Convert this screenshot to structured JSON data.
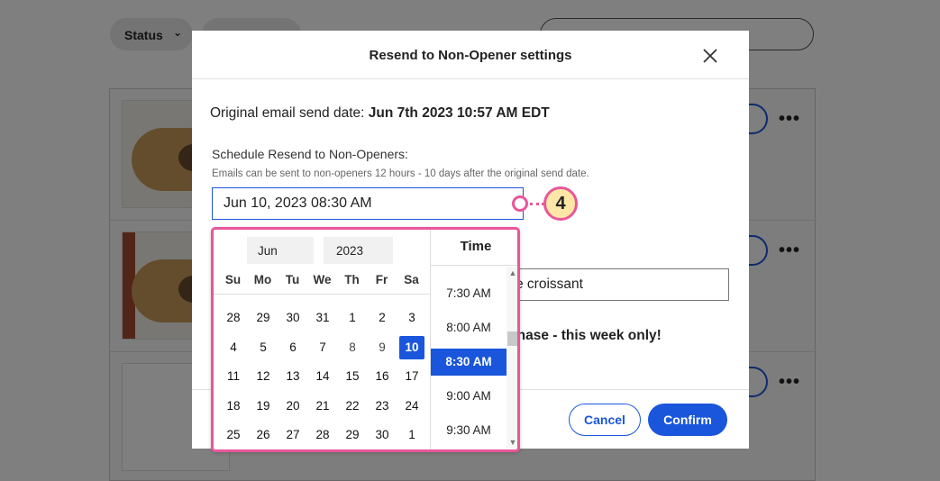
{
  "background": {
    "status_filter_label": "Status",
    "chevron_glyph": "⌄",
    "more_glyph": "•••"
  },
  "modal": {
    "title": "Resend to Non-Opener settings",
    "original_send_label": "Original email send date:",
    "original_send_value": "Jun 7th 2023 10:57 AM EDT",
    "schedule_label": "Schedule Resend to Non-Openers:",
    "schedule_hint": "Emails can be sent to non-openers 12 hours - 10 days after the original send date.",
    "date_input_value": "Jun 10, 2023 08:30 AM",
    "partial_field_text": "e croissant",
    "partial_subject_text": "chase - this week only!",
    "cancel_label": "Cancel",
    "confirm_label": "Confirm"
  },
  "datepicker": {
    "month": "Jun",
    "year": "2023",
    "weekdays": [
      "Su",
      "Mo",
      "Tu",
      "We",
      "Th",
      "Fr",
      "Sa"
    ],
    "weeks": [
      [
        "28",
        "29",
        "30",
        "31",
        "1",
        "2",
        "3"
      ],
      [
        "4",
        "5",
        "6",
        "7",
        "8",
        "9",
        "10"
      ],
      [
        "11",
        "12",
        "13",
        "14",
        "15",
        "16",
        "17"
      ],
      [
        "18",
        "19",
        "20",
        "21",
        "22",
        "23",
        "24"
      ],
      [
        "25",
        "26",
        "27",
        "28",
        "29",
        "30",
        "1"
      ]
    ],
    "selected_day": "10",
    "time_header": "Time",
    "times": [
      "7:30 AM",
      "8:00 AM",
      "8:30 AM",
      "9:00 AM",
      "9:30 AM"
    ],
    "selected_time": "8:30 AM"
  },
  "callout": {
    "step_number": "4",
    "color": "#e8569a",
    "fill": "#fde6a6"
  },
  "colors": {
    "accent": "#1a56db"
  }
}
